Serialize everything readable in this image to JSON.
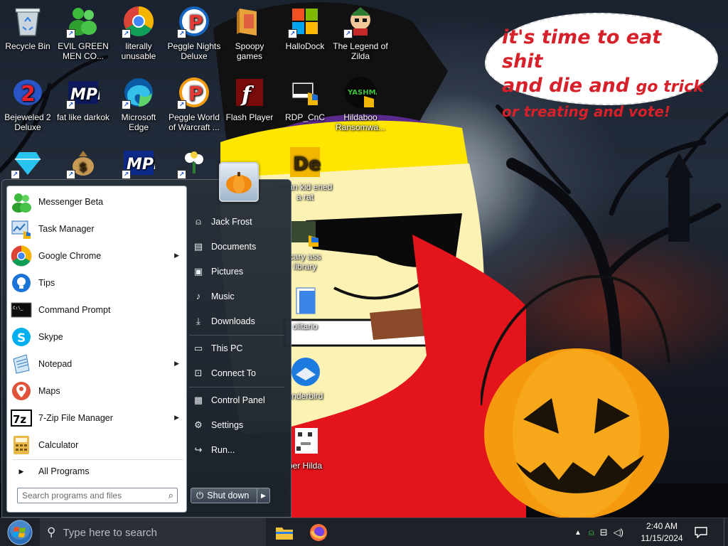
{
  "desktop": {
    "icons": [
      {
        "label": "Recycle Bin",
        "icon": "recycle-bin-icon"
      },
      {
        "label": "EVIL GREEN MEN CO...",
        "icon": "messenger-people-icon"
      },
      {
        "label": "literally unusable",
        "icon": "chrome-icon"
      },
      {
        "label": "Peggle Nights Deluxe",
        "icon": "peggle-icon"
      },
      {
        "label": "Spoopy games",
        "icon": "folder-icon"
      },
      {
        "label": "HalloDock",
        "icon": "windows-logo-icon"
      },
      {
        "label": "The Legend of Zilda",
        "icon": "zelda-character-icon"
      },
      {
        "label": "Bejeweled 2 Deluxe",
        "icon": "bejeweled-icon"
      },
      {
        "label": "fat like darkok",
        "icon": "mpl-icon"
      },
      {
        "label": "Microsoft Edge",
        "icon": "edge-icon"
      },
      {
        "label": "Peggle World of Warcraft ...",
        "icon": "peggle-icon"
      },
      {
        "label": "Flash Player",
        "icon": "flash-player-icon"
      },
      {
        "label": "RDP_CnC",
        "icon": "rdp-icon"
      },
      {
        "label": "Hildaboo Ransomwa...",
        "icon": "yashma-icon"
      },
      {
        "label": "",
        "icon": "diamond-icon"
      },
      {
        "label": "",
        "icon": "money-bag-icon"
      },
      {
        "label": "",
        "icon": "mpi-icon"
      },
      {
        "label": "",
        "icon": "flower-icon"
      },
      {
        "label": "ssian kid ened a rat",
        "icon": "de-icon"
      },
      {
        "label": "cary ass library",
        "icon": "library-icon"
      },
      {
        "label": "olitario",
        "icon": "solitaire-icon"
      },
      {
        "label": "underbird",
        "icon": "thunderbird-icon"
      },
      {
        "label": "per Hilda",
        "icon": "pixel-cat-icon"
      }
    ],
    "bubble": {
      "line1": "it's time to eat shit",
      "line2a": "and die and",
      "line2b": "go trick",
      "line3": "or treating and vote!"
    }
  },
  "start_menu": {
    "pinned": [
      {
        "label": "Messenger Beta",
        "icon": "messenger-icon",
        "submenu": false
      },
      {
        "label": "Task Manager",
        "icon": "task-manager-icon",
        "submenu": false
      },
      {
        "label": "Google Chrome",
        "icon": "chrome-icon",
        "submenu": true
      },
      {
        "label": "Tips",
        "icon": "tips-icon",
        "submenu": false
      },
      {
        "label": "Command Prompt",
        "icon": "command-prompt-icon",
        "submenu": false
      },
      {
        "label": "Skype",
        "icon": "skype-icon",
        "submenu": false
      },
      {
        "label": "Notepad",
        "icon": "notepad-icon",
        "submenu": true
      },
      {
        "label": "Maps",
        "icon": "maps-icon",
        "submenu": false
      },
      {
        "label": "7-Zip File Manager",
        "icon": "7zip-icon",
        "submenu": true
      },
      {
        "label": "Calculator",
        "icon": "calculator-icon",
        "submenu": false
      }
    ],
    "all_programs": "All Programs",
    "search_placeholder": "Search programs and files",
    "right": [
      {
        "label": "Jack Frost",
        "icon": "user-icon"
      },
      {
        "label": "Documents",
        "icon": "documents-icon"
      },
      {
        "label": "Pictures",
        "icon": "pictures-icon"
      },
      {
        "label": "Music",
        "icon": "music-icon"
      },
      {
        "label": "Downloads",
        "icon": "downloads-icon"
      },
      {
        "label": "This PC",
        "icon": "computer-icon"
      },
      {
        "label": "Connect To",
        "icon": "connect-icon"
      },
      {
        "label": "Control Panel",
        "icon": "control-panel-icon"
      },
      {
        "label": "Settings",
        "icon": "settings-icon"
      },
      {
        "label": "Run...",
        "icon": "run-icon"
      }
    ],
    "shutdown_label": "Shut down"
  },
  "taskbar": {
    "search_placeholder": "Type here to search",
    "apps": [
      {
        "name": "File Explorer",
        "icon": "file-explorer-icon"
      },
      {
        "name": "Firefox",
        "icon": "firefox-icon"
      }
    ],
    "time": "2:40 AM",
    "date": "11/15/2024"
  },
  "colors": {
    "bubble_text": "#d6202a",
    "start_left_bg": "#ffffff",
    "start_right_bg": "#2a3039",
    "taskbar_bg": "#1e2128"
  }
}
